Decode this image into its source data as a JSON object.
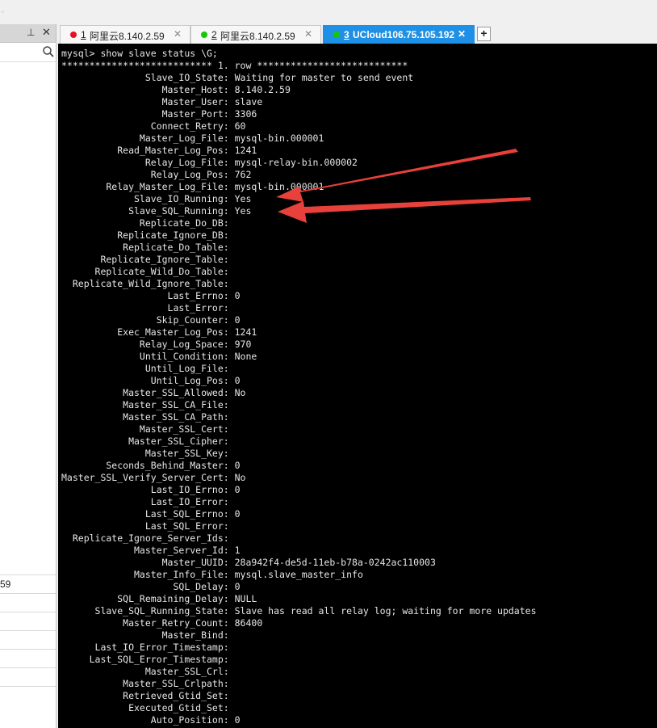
{
  "left_panel": {
    "pin_icon": "pin-icon",
    "close_icon": "close-icon",
    "search_icon": "search-icon",
    "rows": [
      "59",
      "",
      "",
      "",
      "",
      ""
    ]
  },
  "tabs": [
    {
      "num": "1",
      "label": "阿里云8.140.2.59",
      "dot_color": "#e81123",
      "active": false
    },
    {
      "num": "2",
      "label": "阿里云8.140.2.59",
      "dot_color": "#16c60c",
      "active": false
    },
    {
      "num": "3",
      "label": "UCloud106.75.105.192",
      "dot_color": "#16c60c",
      "active": true
    }
  ],
  "tab_add_label": "+",
  "terminal": {
    "lines": [
      "mysql> show slave status \\G;",
      "*************************** 1. row ***************************",
      "               Slave_IO_State: Waiting for master to send event",
      "                  Master_Host: 8.140.2.59",
      "                  Master_User: slave",
      "                  Master_Port: 3306",
      "                Connect_Retry: 60",
      "              Master_Log_File: mysql-bin.000001",
      "          Read_Master_Log_Pos: 1241",
      "               Relay_Log_File: mysql-relay-bin.000002",
      "                Relay_Log_Pos: 762",
      "        Relay_Master_Log_File: mysql-bin.000001",
      "             Slave_IO_Running: Yes",
      "            Slave_SQL_Running: Yes",
      "              Replicate_Do_DB: ",
      "          Replicate_Ignore_DB: ",
      "           Replicate_Do_Table: ",
      "       Replicate_Ignore_Table: ",
      "      Replicate_Wild_Do_Table: ",
      "  Replicate_Wild_Ignore_Table: ",
      "                   Last_Errno: 0",
      "                   Last_Error: ",
      "                 Skip_Counter: 0",
      "          Exec_Master_Log_Pos: 1241",
      "              Relay_Log_Space: 970",
      "              Until_Condition: None",
      "               Until_Log_File: ",
      "                Until_Log_Pos: 0",
      "           Master_SSL_Allowed: No",
      "           Master_SSL_CA_File: ",
      "           Master_SSL_CA_Path: ",
      "              Master_SSL_Cert: ",
      "            Master_SSL_Cipher: ",
      "               Master_SSL_Key: ",
      "        Seconds_Behind_Master: 0",
      "Master_SSL_Verify_Server_Cert: No",
      "                Last_IO_Errno: 0",
      "                Last_IO_Error: ",
      "               Last_SQL_Errno: 0",
      "               Last_SQL_Error: ",
      "  Replicate_Ignore_Server_Ids: ",
      "             Master_Server_Id: 1",
      "                  Master_UUID: 28a942f4-de5d-11eb-b78a-0242ac110003",
      "             Master_Info_File: mysql.slave_master_info",
      "                    SQL_Delay: 0",
      "          SQL_Remaining_Delay: NULL",
      "      Slave_SQL_Running_State: Slave has read all relay log; waiting for more updates",
      "           Master_Retry_Count: 86400",
      "                  Master_Bind: ",
      "      Last_IO_Error_Timestamp: ",
      "     Last_SQL_Error_Timestamp: ",
      "               Master_SSL_Crl: ",
      "           Master_SSL_Crlpath: ",
      "           Retrieved_Gtid_Set: ",
      "            Executed_Gtid_Set: ",
      "                Auto_Position: 0"
    ],
    "annotation_color": "#e8403a"
  }
}
